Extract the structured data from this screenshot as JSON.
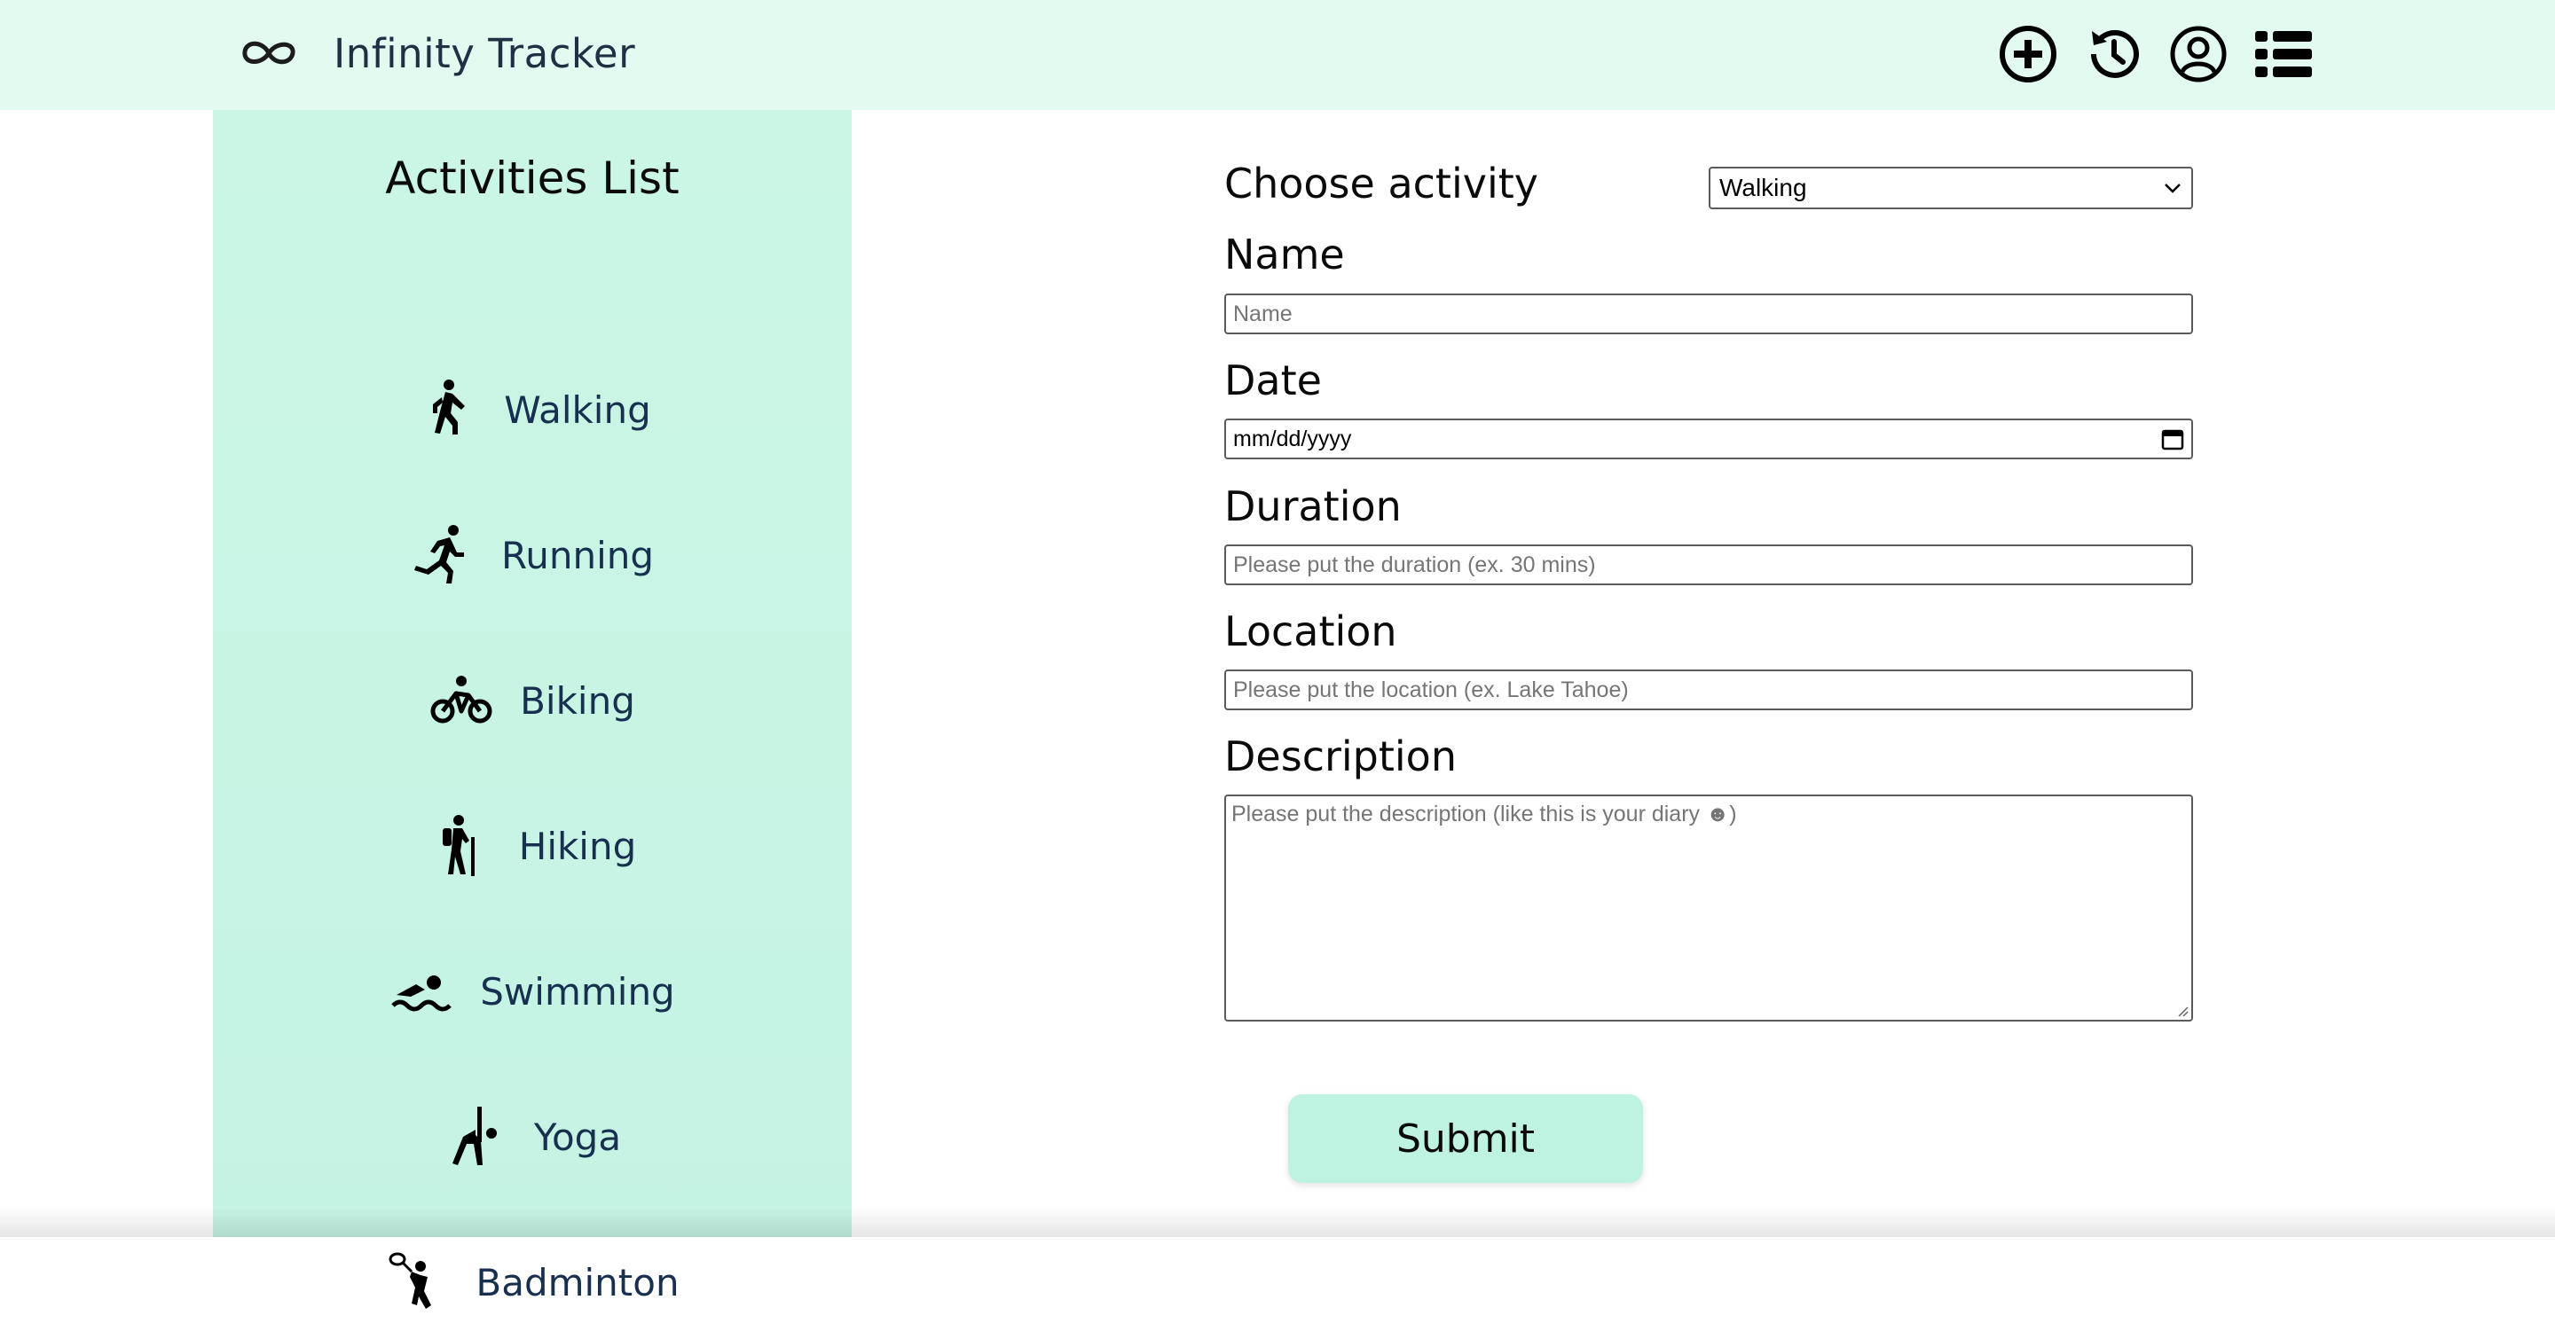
{
  "header": {
    "app_title": "Infinity Tracker",
    "logo_icon": "infinity-icon",
    "nav_icons": [
      "add-circle-icon",
      "history-icon",
      "user-profile-icon",
      "list-icon"
    ],
    "bg_color": "#e2faf0"
  },
  "sidebar": {
    "title": "Activities List",
    "bg_color": "#c8f5e4",
    "items": [
      {
        "label": "Walking",
        "icon": "walking-icon"
      },
      {
        "label": "Running",
        "icon": "running-icon"
      },
      {
        "label": "Biking",
        "icon": "biking-icon"
      },
      {
        "label": "Hiking",
        "icon": "hiking-icon"
      },
      {
        "label": "Swimming",
        "icon": "swimming-icon"
      },
      {
        "label": "Yoga",
        "icon": "yoga-icon"
      },
      {
        "label": "Badminton",
        "icon": "badminton-icon"
      }
    ]
  },
  "form": {
    "choose_label": "Choose activity",
    "activity_selected": "Walking",
    "name_label": "Name",
    "name_placeholder": "Name",
    "date_label": "Date",
    "date_placeholder": "mm/dd/yyyy",
    "duration_label": "Duration",
    "duration_placeholder": "Please put the duration (ex. 30 mins)",
    "location_label": "Location",
    "location_placeholder": "Please put the location (ex. Lake Tahoe)",
    "description_label": "Description",
    "description_placeholder": "Please put the description (like this is your diary ☻)",
    "submit_label": "Submit",
    "submit_color": "#bdf3e0"
  }
}
